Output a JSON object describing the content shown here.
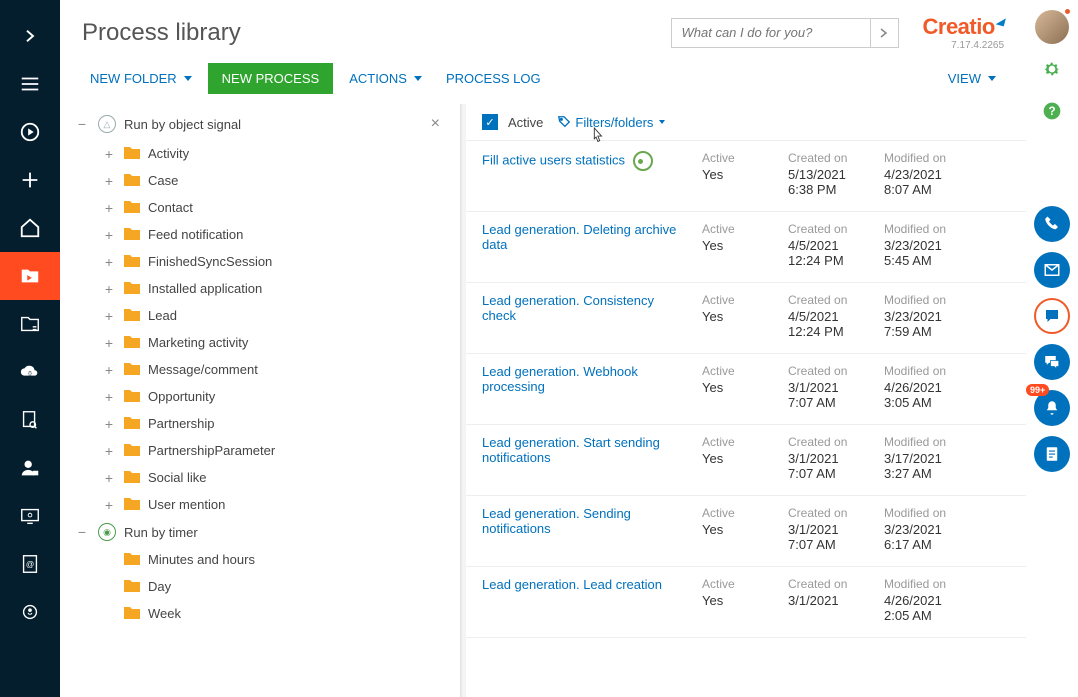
{
  "header": {
    "title": "Process library",
    "search_placeholder": "What can I do for you?",
    "logo": "Creatio",
    "version": "7.17.4.2265"
  },
  "toolbar": {
    "new_folder": "NEW FOLDER",
    "new_process": "NEW PROCESS",
    "actions": "ACTIONS",
    "process_log": "PROCESS LOG",
    "view": "VIEW"
  },
  "filter": {
    "active_label": "Active",
    "filters_folders": "Filters/folders"
  },
  "tree": {
    "groups": [
      {
        "name": "Run by object signal",
        "circle_tint": "gray",
        "collapsible": true,
        "closable": true,
        "children": [
          {
            "label": "Activity",
            "plus": true
          },
          {
            "label": "Case",
            "plus": true
          },
          {
            "label": "Contact",
            "plus": true
          },
          {
            "label": "Feed notification",
            "plus": true
          },
          {
            "label": "FinishedSyncSession",
            "plus": true
          },
          {
            "label": "Installed application",
            "plus": true
          },
          {
            "label": "Lead",
            "plus": true
          },
          {
            "label": "Marketing activity",
            "plus": true
          },
          {
            "label": "Message/comment",
            "plus": true
          },
          {
            "label": "Opportunity",
            "plus": true
          },
          {
            "label": "Partnership",
            "plus": true
          },
          {
            "label": "PartnershipParameter",
            "plus": true
          },
          {
            "label": "Social like",
            "plus": true
          },
          {
            "label": "User mention",
            "plus": true
          }
        ]
      },
      {
        "name": "Run by timer",
        "circle_tint": "green",
        "collapsible": true,
        "closable": false,
        "children": [
          {
            "label": "Minutes and hours",
            "plus": false
          },
          {
            "label": "Day",
            "plus": false
          },
          {
            "label": "Week",
            "plus": false
          }
        ]
      }
    ]
  },
  "columns": {
    "active": "Active",
    "created": "Created on",
    "modified": "Modified on"
  },
  "records": [
    {
      "title": "Fill active users statistics",
      "gauge": true,
      "active": "Yes",
      "created": "5/13/2021 6:38 PM",
      "modified": "4/23/2021 8:07 AM"
    },
    {
      "title": "Lead generation. Deleting archive data",
      "active": "Yes",
      "created": "4/5/2021 12:24 PM",
      "modified": "3/23/2021 5:45 AM"
    },
    {
      "title": "Lead generation. Consistency check",
      "active": "Yes",
      "created": "4/5/2021 12:24 PM",
      "modified": "3/23/2021 7:59 AM"
    },
    {
      "title": "Lead generation. Webhook processing",
      "active": "Yes",
      "created": "3/1/2021 7:07 AM",
      "modified": "4/26/2021 3:05 AM"
    },
    {
      "title": "Lead generation. Start sending notifications",
      "active": "Yes",
      "created": "3/1/2021 7:07 AM",
      "modified": "3/17/2021 3:27 AM"
    },
    {
      "title": "Lead generation. Sending notifications",
      "active": "Yes",
      "created": "3/1/2021 7:07 AM",
      "modified": "3/23/2021 6:17 AM"
    },
    {
      "title": "Lead generation. Lead creation",
      "active": "Yes",
      "created": "3/1/2021",
      "modified": "4/26/2021 2:05 AM"
    }
  ],
  "right_panel": {
    "notification_badge": "99+"
  }
}
